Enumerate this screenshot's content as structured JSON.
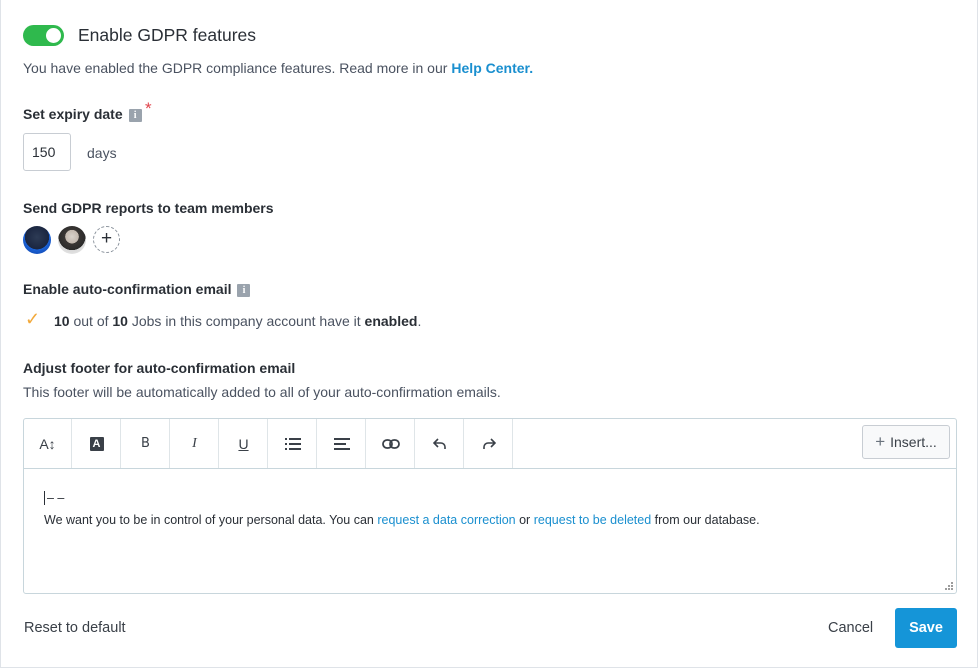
{
  "gdpr_toggle": {
    "label": "Enable GDPR features",
    "enabled": true
  },
  "intro": {
    "text": "You have enabled the GDPR compliance features. Read more in our",
    "link": "Help Center."
  },
  "expiry": {
    "label": "Set expiry date",
    "info": "i",
    "required_mark": "*",
    "value": "150",
    "unit": "days"
  },
  "reports": {
    "label": "Send GDPR reports to team members",
    "add_icon": "+"
  },
  "auto_confirm": {
    "label": "Enable auto-confirmation email",
    "info": "i",
    "check": "✓",
    "count": "10",
    "out_of": "out of",
    "total": "10",
    "middle": "Jobs in this company account have it",
    "state": "enabled",
    "end": "."
  },
  "footer_section": {
    "label": "Adjust footer for auto-confirmation email",
    "description": "This footer will be automatically added to all of your auto-confirmation emails."
  },
  "editor": {
    "toolbar": {
      "font_size": "A↕",
      "text_color": "A",
      "bold": "B",
      "italic": "I",
      "underline": "U",
      "list_icon": "bulleted-list-icon",
      "align_icon": "align-left-icon",
      "link_icon": "link-icon",
      "undo_icon": "undo-icon",
      "redo_icon": "redo-icon",
      "insert_plus": "+",
      "insert_label": "Insert..."
    },
    "signature_dash": "– –",
    "body_start": "We want you to be in control of your personal data. You can",
    "link1": "request a data correction",
    "or": "or",
    "link2": "request to be deleted",
    "body_end": "from our database."
  },
  "actions": {
    "reset": "Reset to default",
    "cancel": "Cancel",
    "save": "Save"
  },
  "colors": {
    "toggle_on": "#2fb94d",
    "link": "#1a8fcf",
    "primary_button": "#1595d8",
    "required": "#e0434b",
    "check": "#f2a93b"
  }
}
